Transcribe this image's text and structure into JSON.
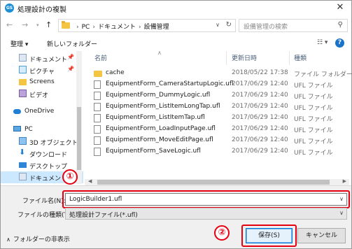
{
  "window": {
    "title": "処理設計の複製",
    "app_icon_label": "GS",
    "close_glyph": "✕"
  },
  "address": {
    "crumbs": [
      "PC",
      "ドキュメント",
      "設備管理"
    ],
    "separator": "›"
  },
  "search": {
    "placeholder": "設備管理の検索"
  },
  "toolbar": {
    "organize": "整理 ▾",
    "new_folder": "新しいフォルダー",
    "help": "?"
  },
  "navpane": {
    "items": [
      {
        "label": "ドキュメント",
        "icon": "documents-icon",
        "pinned": true
      },
      {
        "label": "ピクチャ",
        "icon": "pictures-icon",
        "pinned": true
      },
      {
        "label": "Screens",
        "icon": "folder-icon",
        "pinned": false
      },
      {
        "label": "ビデオ",
        "icon": "videos-icon",
        "pinned": false
      },
      {
        "label": "OneDrive",
        "icon": "onedrive-icon",
        "pinned": false
      },
      {
        "label": "PC",
        "icon": "pc-icon",
        "pinned": false
      },
      {
        "label": "3D オブジェクト",
        "icon": "3d-objects-icon",
        "pinned": false
      },
      {
        "label": "ダウンロード",
        "icon": "downloads-icon",
        "pinned": false
      },
      {
        "label": "デスクトップ",
        "icon": "desktop-icon",
        "pinned": false
      },
      {
        "label": "ドキュメント",
        "icon": "documents-icon",
        "pinned": false
      }
    ]
  },
  "filelist": {
    "columns": {
      "name": "名前",
      "date": "更新日時",
      "type": "種類"
    },
    "rows": [
      {
        "name": "cache",
        "date": "2018/05/22 17:38",
        "type": "ファイル フォルダー",
        "kind": "folder"
      },
      {
        "name": "EquipmentForm_CameraStartupLogic.ufl",
        "date": "2017/06/29 12:40",
        "type": "UFL ファイル",
        "kind": "file"
      },
      {
        "name": "EquipmentForm_DummyLogic.ufl",
        "date": "2017/06/29 12:40",
        "type": "UFL ファイル",
        "kind": "file"
      },
      {
        "name": "EquipmentForm_ListItemLongTap.ufl",
        "date": "2017/06/29 12:40",
        "type": "UFL ファイル",
        "kind": "file"
      },
      {
        "name": "EquipmentForm_ListItemTap.ufl",
        "date": "2017/06/29 12:40",
        "type": "UFL ファイル",
        "kind": "file"
      },
      {
        "name": "EquipmentForm_LoadInputPage.ufl",
        "date": "2017/06/29 12:40",
        "type": "UFL ファイル",
        "kind": "file"
      },
      {
        "name": "EquipmentForm_MoveEditPage.ufl",
        "date": "2017/06/29 12:40",
        "type": "UFL ファイル",
        "kind": "file"
      },
      {
        "name": "EquipmentForm_SaveLogic.ufl",
        "date": "2017/06/29 12:40",
        "type": "UFL ファイル",
        "kind": "file"
      }
    ]
  },
  "form": {
    "filename_label": "ファイル名(N):",
    "filename_value": "LogicBuilder1.ufl",
    "filetype_label": "ファイルの種類(T):",
    "filetype_value": "処理設計ファイル(*.ufl)",
    "hide_folders": "フォルダーの非表示",
    "save": "保存(S)",
    "cancel": "キャンセル"
  },
  "annotations": {
    "badge1": "①",
    "badge2": "②",
    "color": "#e60012"
  }
}
